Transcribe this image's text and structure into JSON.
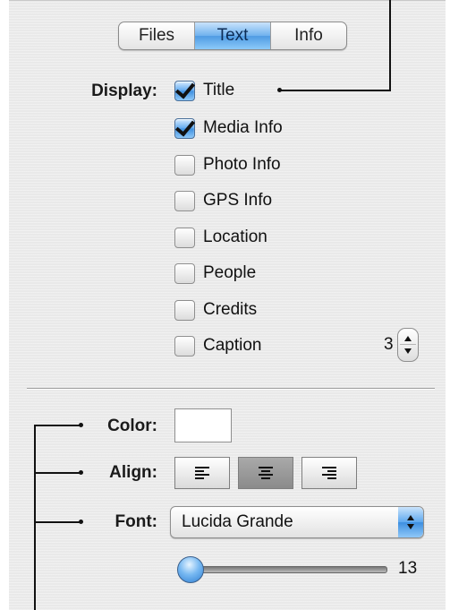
{
  "tabs": [
    {
      "label": "Files",
      "active": false
    },
    {
      "label": "Text",
      "active": true
    },
    {
      "label": "Info",
      "active": false
    }
  ],
  "display": {
    "label": "Display:",
    "options": [
      {
        "label": "Title",
        "checked": true
      },
      {
        "label": "Media Info",
        "checked": true
      },
      {
        "label": "Photo Info",
        "checked": false
      },
      {
        "label": "GPS Info",
        "checked": false
      },
      {
        "label": "Location",
        "checked": false
      },
      {
        "label": "People",
        "checked": false
      },
      {
        "label": "Credits",
        "checked": false
      },
      {
        "label": "Caption",
        "checked": false
      }
    ],
    "caption_lines": "3"
  },
  "color": {
    "label": "Color:",
    "value": "#ffffff"
  },
  "align": {
    "label": "Align:",
    "options": [
      "left",
      "center",
      "right"
    ],
    "selected": "center"
  },
  "font": {
    "label": "Font:",
    "value": "Lucida Grande",
    "size": "13"
  }
}
